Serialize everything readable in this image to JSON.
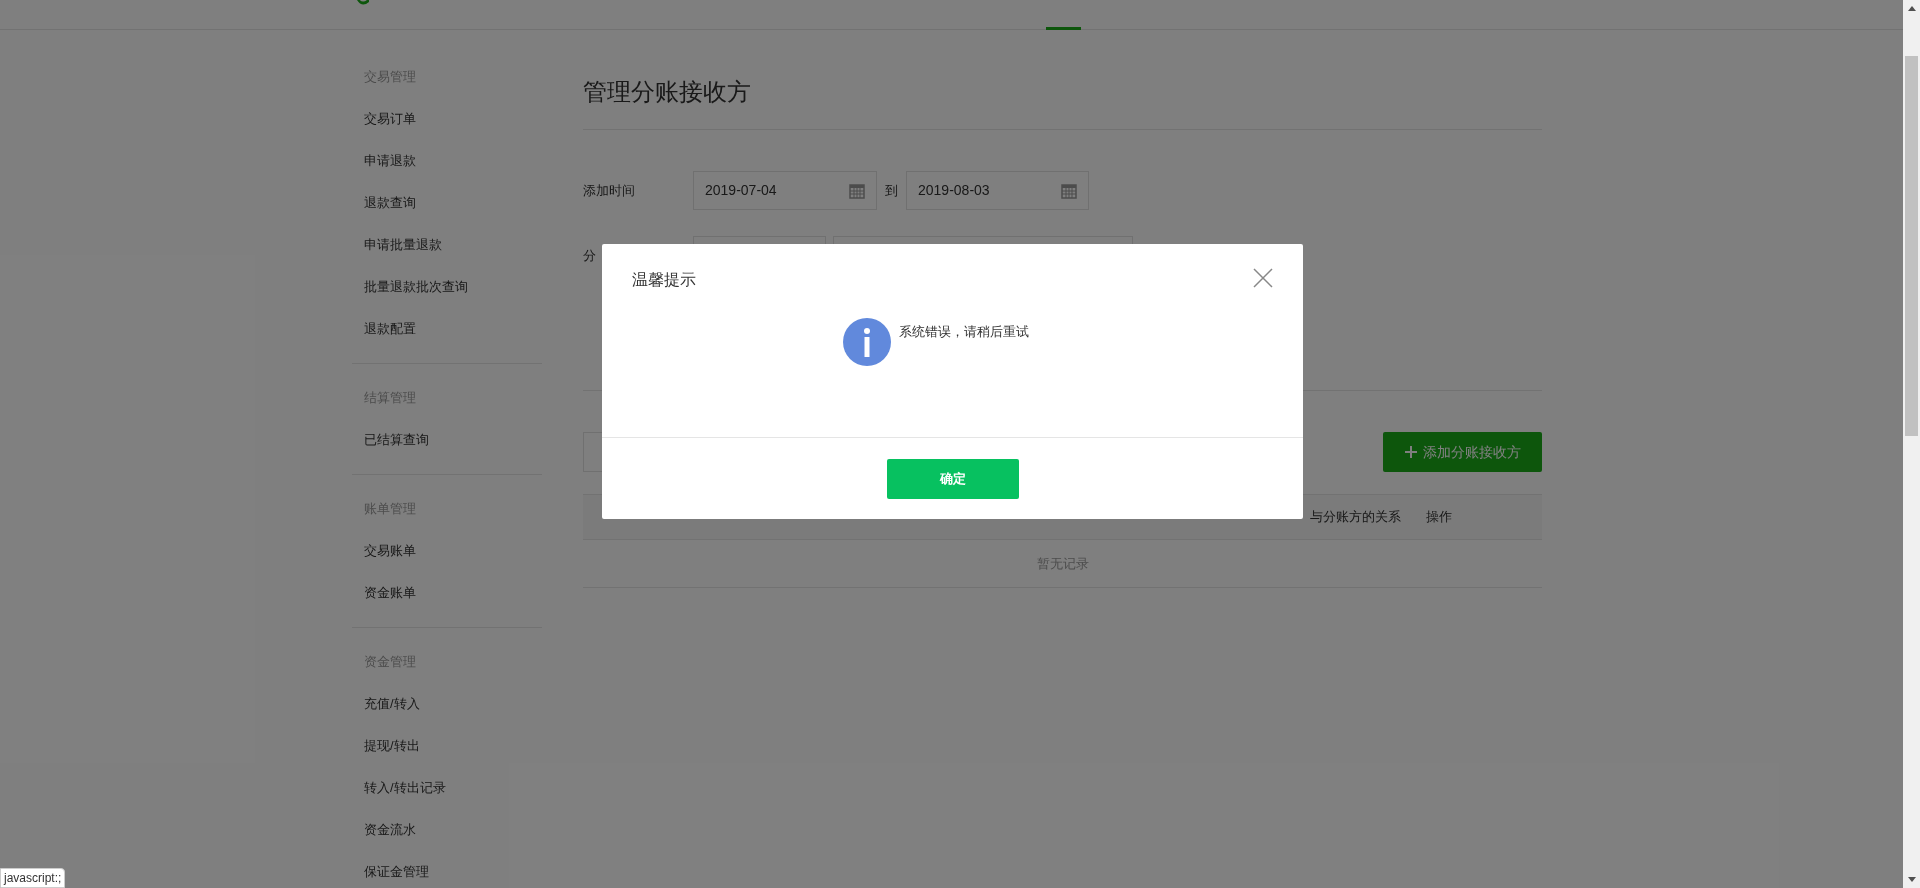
{
  "sidebar": {
    "groups": [
      {
        "title": "交易管理",
        "items": [
          "交易订单",
          "申请退款",
          "退款查询",
          "申请批量退款",
          "批量退款批次查询",
          "退款配置"
        ]
      },
      {
        "title": "结算管理",
        "items": [
          "已结算查询"
        ]
      },
      {
        "title": "账单管理",
        "items": [
          "交易账单",
          "资金账单"
        ]
      },
      {
        "title": "资金管理",
        "items": [
          "充值/转入",
          "提现/转出",
          "转入/转出记录",
          "资金流水",
          "保证金管理"
        ]
      }
    ]
  },
  "page": {
    "title": "管理分账接收方",
    "date_filter": {
      "label": "添加时间",
      "start": "2019-07-04",
      "separator": "到",
      "end": "2019-08-03"
    },
    "second_filter": {
      "label": "分"
    },
    "add_button": "添加分账接收方",
    "table": {
      "visible_columns": [
        "与分账方的关系",
        "操作"
      ],
      "empty_text": "暂无记录"
    }
  },
  "dialog": {
    "title": "温馨提示",
    "message": "系统错误，请稍后重试",
    "button": "确定"
  },
  "status_tooltip": "javascript:;"
}
